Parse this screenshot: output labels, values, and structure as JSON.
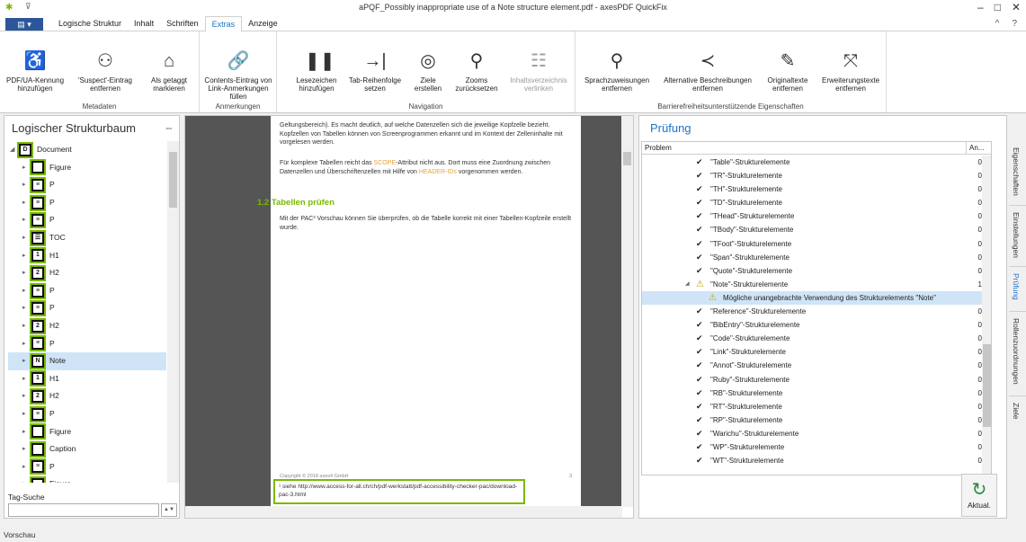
{
  "window": {
    "title": "aPQF_Possibly inappropriate use of a Note structure element.pdf - axesPDF QuickFix",
    "qa_label": "⊽",
    "minimize": "–",
    "maximize": "□",
    "close": "✕"
  },
  "menubar": {
    "file_label": "▤ ▾",
    "tabs": [
      "Logische Struktur",
      "Inhalt",
      "Schriften",
      "Extras",
      "Anzeige"
    ],
    "collapse": "^",
    "help": "?"
  },
  "ribbon": {
    "metadaten": {
      "label": "Metadaten",
      "buttons": [
        "PDF/UA-Kennung hinzufügen",
        "'Suspect'-Eintrag entfernen",
        "Als getaggt markieren"
      ]
    },
    "anmerkungen": {
      "label": "Anmerkungen",
      "buttons": [
        "Contents-Eintrag von Link-Anmerkungen füllen"
      ]
    },
    "navigation": {
      "label": "Navigation",
      "buttons": [
        "Lesezeichen hinzufügen",
        "Tab-Reihenfolge setzen",
        "Ziele erstellen",
        "Zooms zurücksetzen",
        "Inhaltsverzeichnis verlinken"
      ]
    },
    "barriere": {
      "label": "Barrierefreiheitsunterstützende Eigenschaften",
      "buttons": [
        "Sprachzuweisungen entfernen",
        "Alternative Beschreibungen entfernen",
        "Originaltexte entfernen",
        "Erweiterungstexte entfernen"
      ]
    }
  },
  "left_panel": {
    "title": "Logischer Strukturbaum",
    "pin": "ꟷ",
    "tree": [
      {
        "label": "Document",
        "tag": "D"
      },
      {
        "label": "Figure",
        "tag": ""
      },
      {
        "label": "P",
        "tag": "≡"
      },
      {
        "label": "P",
        "tag": "≡"
      },
      {
        "label": "P",
        "tag": "≡"
      },
      {
        "label": "TOC",
        "tag": "☰"
      },
      {
        "label": "H1",
        "tag": "1"
      },
      {
        "label": "H2",
        "tag": "2"
      },
      {
        "label": "P",
        "tag": "≡"
      },
      {
        "label": "P",
        "tag": "≡"
      },
      {
        "label": "H2",
        "tag": "2"
      },
      {
        "label": "P",
        "tag": "≡"
      },
      {
        "label": "Note",
        "tag": "N"
      },
      {
        "label": "H1",
        "tag": "1"
      },
      {
        "label": "H2",
        "tag": "2"
      },
      {
        "label": "P",
        "tag": "≡"
      },
      {
        "label": "Figure",
        "tag": ""
      },
      {
        "label": "Caption",
        "tag": ""
      },
      {
        "label": "P",
        "tag": "≡"
      },
      {
        "label": "Figure",
        "tag": ""
      }
    ],
    "tag_search_label": "Tag-Suche",
    "tag_search_value": ""
  },
  "document": {
    "para1": "Geltungsbereich). Es macht deutlich, auf welche Datenzellen sich die jeweilige Kopfzelle bezieht. Kopfzellen von Tabellen können von Screenprogrammen erkannt und im Kontext der Zelleninhalte mit vorgelesen werden.",
    "para2_pre": "Für komplexe Tabellen reicht das ",
    "scope": "SCOPE",
    "para2_mid": "-Attribut nicht aus. Dort muss eine Zuordnung zwischen Datenzellen und Überschriftenzellen mit Hilfe von ",
    "header_ids": "HEADER-IDs",
    "para2_post": " vorgenommen werden.",
    "heading": "1.2  Tabellen prüfen",
    "para3": "Mit der PAC³ Vorschau können Sie überprüfen, ob die Tabelle korrekt mit einer Tabellen-Kopfzeile erstellt wurde.",
    "copyright": "Copyright © 2018 axes4 GmbH",
    "page_number": "3",
    "footnote": "¹ siehe http://www.access-for-all.ch/ch/pdf-werkstatt/pdf-accessibility-checker-pac/download-pac-3.html"
  },
  "right_panel": {
    "title": "Prüfung",
    "col_problem": "Problem",
    "col_count": "An...",
    "rows": [
      {
        "label": "\"Table\"-Strukturelemente",
        "count": "0"
      },
      {
        "label": "\"TR\"-Strukturelemente",
        "count": "0"
      },
      {
        "label": "\"TH\"-Strukturelemente",
        "count": "0"
      },
      {
        "label": "\"TD\"-Strukturelemente",
        "count": "0"
      },
      {
        "label": "\"THead\"-Strukturelemente",
        "count": "0"
      },
      {
        "label": "\"TBody\"-Strukturelemente",
        "count": "0"
      },
      {
        "label": "\"TFoot\"-Strukturelemente",
        "count": "0"
      },
      {
        "label": "\"Span\"-Strukturelemente",
        "count": "0"
      },
      {
        "label": "\"Quote\"-Strukturelemente",
        "count": "0"
      },
      {
        "label": "\"Note\"-Strukturelemente",
        "count": "1",
        "warn": true
      },
      {
        "label": "Mögliche unangebrachte Verwendung des Strukturelements \"Note\"",
        "count": "",
        "sub": true
      },
      {
        "label": "\"Reference\"-Strukturelemente",
        "count": "0"
      },
      {
        "label": "\"BibEntry\"-Strukturelemente",
        "count": "0"
      },
      {
        "label": "\"Code\"-Strukturelemente",
        "count": "0"
      },
      {
        "label": "\"Link\"-Strukturelemente",
        "count": "0"
      },
      {
        "label": "\"Annot\"-Strukturelemente",
        "count": "0"
      },
      {
        "label": "\"Ruby\"-Strukturelemente",
        "count": "0"
      },
      {
        "label": "\"RB\"-Strukturelemente",
        "count": "0"
      },
      {
        "label": "\"RT\"-Strukturelemente",
        "count": "0"
      },
      {
        "label": "\"RP\"-Strukturelemente",
        "count": "0"
      },
      {
        "label": "\"Warichu\"-Strukturelemente",
        "count": "0"
      },
      {
        "label": "\"WP\"-Strukturelemente",
        "count": "0"
      },
      {
        "label": "\"WT\"-Strukturelemente",
        "count": "0"
      }
    ],
    "refresh_label": "Aktual."
  },
  "side_tabs": [
    "Eigenschaften",
    "Einstellungen",
    "Prüfung",
    "Rollenzuordnungen",
    "Ziele"
  ],
  "status": "Vorschau"
}
